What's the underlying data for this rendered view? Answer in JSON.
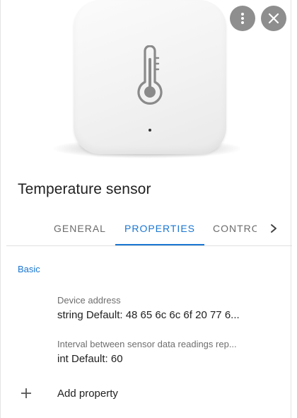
{
  "header": {
    "more_icon": "more-vert-icon",
    "close_icon": "close-icon",
    "device_icon": "thermometer-icon"
  },
  "title": "Temperature sensor",
  "tabs": [
    {
      "label": "GENERAL",
      "selected": false
    },
    {
      "label": "PROPERTIES",
      "selected": true
    },
    {
      "label": "CONTROLS",
      "selected": false
    }
  ],
  "tab_scroll_icon": "chevron-right-icon",
  "properties": {
    "section_label": "Basic",
    "items": [
      {
        "name": "Device address",
        "value": "string Default: 48 65 6c 6c 6f 20 77 6..."
      },
      {
        "name": "Interval between sensor data readings rep...",
        "value": "int Default: 60"
      }
    ],
    "add_label": "Add property",
    "add_icon": "plus-icon"
  },
  "colors": {
    "accent": "#1976d2",
    "button_bg": "#8e8e8e",
    "text_primary": "#212121",
    "text_secondary": "#6e6e6e"
  }
}
